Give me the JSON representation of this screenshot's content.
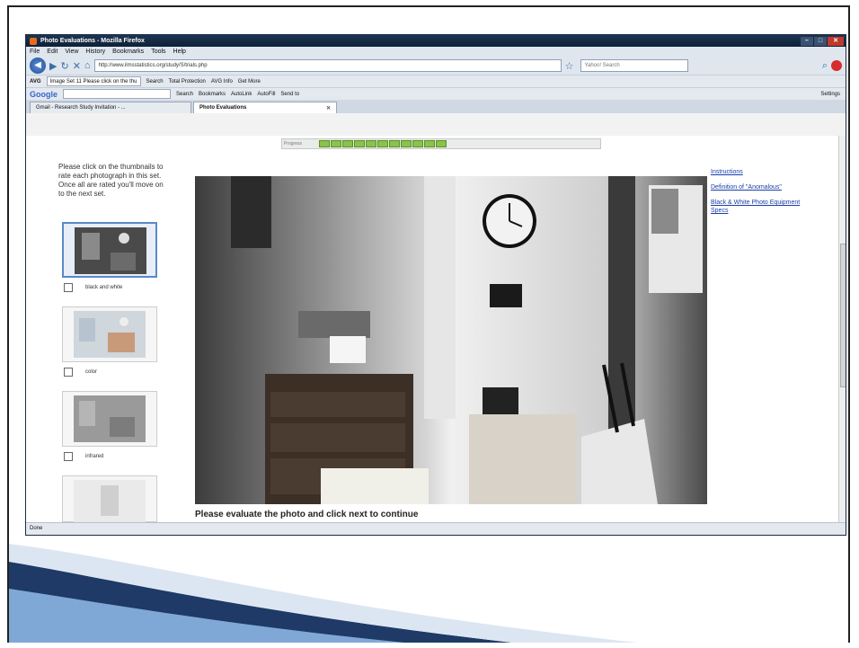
{
  "window": {
    "title": "Photo Evaluations - Mozilla Firefox"
  },
  "menu": [
    "File",
    "Edit",
    "View",
    "History",
    "Bookmarks",
    "Tools",
    "Help"
  ],
  "nav": {
    "url": "http://www.ilmsstatistics.org/study/S/trials.php",
    "search_placeholder": "Yahoo! Search"
  },
  "toolbar": {
    "avg_label": "AVG",
    "image_set_text": "Image Set 11 Please click on the thu",
    "search_label": "Search",
    "total_protection": "Total Protection",
    "avg_info": "AVG Info",
    "get_more": "Get More"
  },
  "googlebar": {
    "logo": "Google",
    "search_label": "Search",
    "bookmarks": "Bookmarks",
    "autolink": "AutoLink",
    "autofill": "AutoFill",
    "send_to": "Send to",
    "settings": "Settings"
  },
  "tabs": [
    {
      "label": "Gmail - Research Study Invitation - ..."
    },
    {
      "label": "Photo Evaluations"
    }
  ],
  "progress": {
    "label": "Progress",
    "completed_segments": 11,
    "total_segments": 22,
    "fraction": 0.5
  },
  "sidebar": {
    "instructions": "Please click on the thumbnails to rate each photograph in this set. Once all are rated you'll move on to the next set.",
    "thumbnails": [
      {
        "label": "black and white"
      },
      {
        "label": "color"
      },
      {
        "label": "infrared"
      }
    ]
  },
  "links": {
    "instructions": "Instructions",
    "definition": "Definition of \"Anomalous\"",
    "bw_specs": "Black & White Photo Equipment Specs"
  },
  "prompt": "Please evaluate the photo and click next to continue",
  "status": "Done",
  "colors": {
    "link": "#1a3ea8",
    "progress": "#8bc34a",
    "titlebar": "#1e3552"
  }
}
